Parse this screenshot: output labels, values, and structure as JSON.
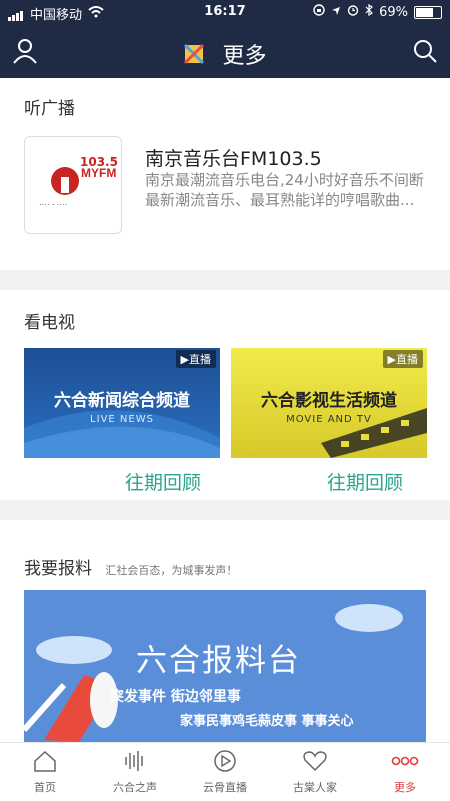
{
  "status": {
    "carrier": "中国移动",
    "time": "16:17",
    "battery": "69%",
    "battery_level": 0.69
  },
  "nav": {
    "title": "更多"
  },
  "radio": {
    "section_title": "听广播",
    "logo_text": "103.5",
    "name": "南京音乐台FM103.5",
    "desc": "南京最潮流音乐电台,24小时好音乐不间断最新潮流音乐、最耳熟能详的哼唱歌曲..."
  },
  "tv": {
    "section_title": "看电视",
    "channels": [
      {
        "live": "▶直播",
        "name": "六合新闻综合频道",
        "en": "LIVE NEWS",
        "review": "往期回顾"
      },
      {
        "live": "▶直播",
        "name": "六合影视生活频道",
        "en": "MOVIE AND TV",
        "review": "往期回顾"
      }
    ]
  },
  "report": {
    "section_title": "我要报料",
    "subtitle": "汇社会百态，为城事发声！",
    "banner_title": "六合报料台",
    "banner_line1": "突发事件  街边邻里事",
    "banner_line2": "家事民事鸡毛蒜皮事  事事关心"
  },
  "tabs": [
    {
      "label": "首页",
      "icon": "home-icon"
    },
    {
      "label": "六合之声",
      "icon": "audio-icon"
    },
    {
      "label": "云骨直播",
      "icon": "play-icon"
    },
    {
      "label": "古棠人家",
      "icon": "heart-icon"
    },
    {
      "label": "更多",
      "icon": "more-icon"
    }
  ],
  "colors": {
    "nav_bg": "#1f2b45",
    "accent_green": "#2aa58c",
    "active_tab": "#e43b3b"
  }
}
